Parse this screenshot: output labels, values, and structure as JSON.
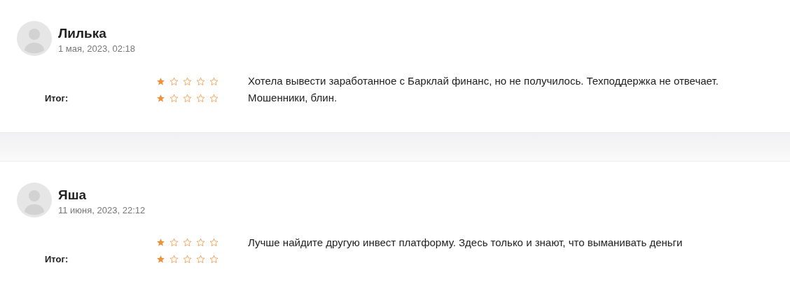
{
  "reviews": [
    {
      "name": "Лилька",
      "date": "1 мая, 2023, 02:18",
      "ratings": [
        {
          "stars": 1
        },
        {
          "label": "Итог:",
          "stars": 1
        }
      ],
      "text": "Хотела вывести заработанное с Барклай финанс, но не получилось. Техподдержка не отвечает. Мошенники, блин."
    },
    {
      "name": "Яша",
      "date": "11 июня, 2023, 22:12",
      "ratings": [
        {
          "stars": 1
        },
        {
          "label": "Итог:",
          "stars": 1
        }
      ],
      "text": "Лучше найдите другую инвест платформу. Здесь только и знают, что выманивать деньги"
    }
  ]
}
